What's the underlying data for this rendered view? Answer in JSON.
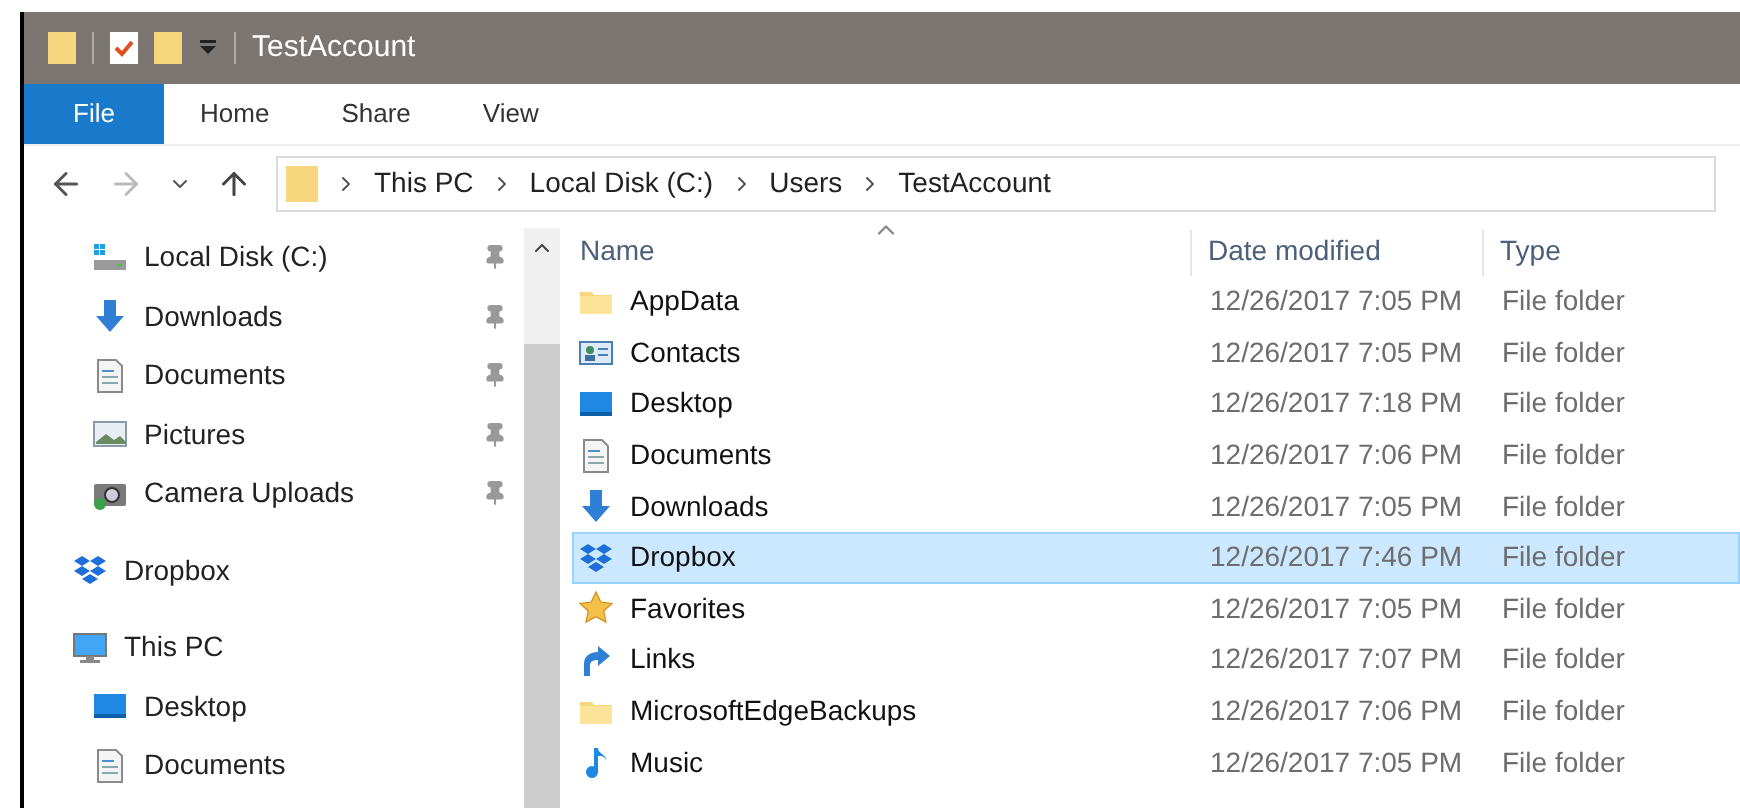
{
  "window": {
    "title": "TestAccount"
  },
  "ribbon_tabs": [
    {
      "label": "File",
      "selected": true
    },
    {
      "label": "Home",
      "selected": false
    },
    {
      "label": "Share",
      "selected": false
    },
    {
      "label": "View",
      "selected": false
    }
  ],
  "address_bar": {
    "path": [
      "This PC",
      "Local Disk (C:)",
      "Users",
      "TestAccount"
    ]
  },
  "quick_access": [
    {
      "label": "Local Disk (C:)",
      "kind": "drive",
      "pinned": true
    },
    {
      "label": "Downloads",
      "kind": "downloads",
      "pinned": true
    },
    {
      "label": "Documents",
      "kind": "documents",
      "pinned": true
    },
    {
      "label": "Pictures",
      "kind": "pictures",
      "pinned": true
    },
    {
      "label": "Camera Uploads",
      "kind": "camera",
      "pinned": true
    }
  ],
  "navigation_tree": [
    {
      "label": "Dropbox",
      "kind": "dropbox"
    },
    {
      "label": "This PC",
      "kind": "pc",
      "children": [
        {
          "label": "Desktop",
          "kind": "desktop"
        },
        {
          "label": "Documents",
          "kind": "documents"
        }
      ]
    }
  ],
  "table": {
    "columns": [
      "Name",
      "Date modified",
      "Type"
    ],
    "rows": [
      {
        "name": "AppData",
        "kind": "folder",
        "date": "12/26/2017 7:05 PM",
        "type": "File folder",
        "selected": false
      },
      {
        "name": "Contacts",
        "kind": "contacts",
        "date": "12/26/2017 7:05 PM",
        "type": "File folder",
        "selected": false
      },
      {
        "name": "Desktop",
        "kind": "desktop",
        "date": "12/26/2017 7:18 PM",
        "type": "File folder",
        "selected": false
      },
      {
        "name": "Documents",
        "kind": "documents",
        "date": "12/26/2017 7:06 PM",
        "type": "File folder",
        "selected": false
      },
      {
        "name": "Downloads",
        "kind": "downloads",
        "date": "12/26/2017 7:05 PM",
        "type": "File folder",
        "selected": false
      },
      {
        "name": "Dropbox",
        "kind": "dropbox",
        "date": "12/26/2017 7:46 PM",
        "type": "File folder",
        "selected": true
      },
      {
        "name": "Favorites",
        "kind": "favorites",
        "date": "12/26/2017 7:05 PM",
        "type": "File folder",
        "selected": false
      },
      {
        "name": "Links",
        "kind": "links",
        "date": "12/26/2017 7:07 PM",
        "type": "File folder",
        "selected": false
      },
      {
        "name": "MicrosoftEdgeBackups",
        "kind": "folder",
        "date": "12/26/2017 7:06 PM",
        "type": "File folder",
        "selected": false
      },
      {
        "name": "Music",
        "kind": "music",
        "date": "12/26/2017 7:05 PM",
        "type": "File folder",
        "selected": false
      }
    ]
  }
}
